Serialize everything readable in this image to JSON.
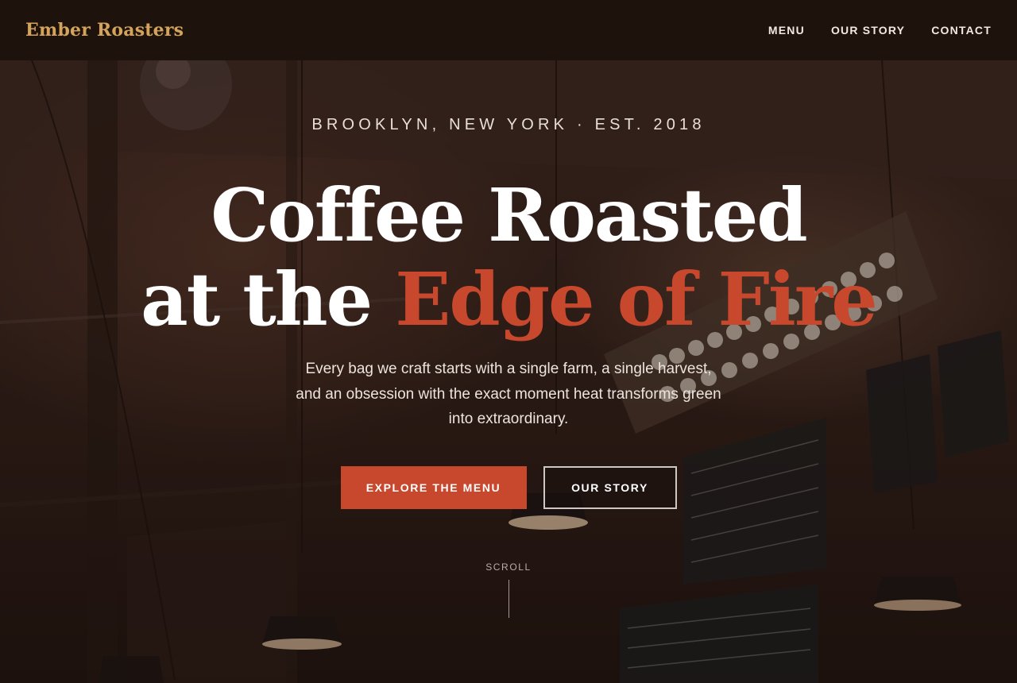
{
  "header": {
    "brand": "Ember Roasters",
    "nav": [
      {
        "label": "MENU"
      },
      {
        "label": "OUR STORY"
      },
      {
        "label": "CONTACT"
      }
    ]
  },
  "hero": {
    "eyebrow": "BROOKLYN, NEW YORK · EST. 2018",
    "headline_line1": "Coffee Roasted",
    "headline_line2_plain": "at the ",
    "headline_line2_accent": "Edge of Fire",
    "subtext": "Every bag we craft starts with a single farm, a single harvest, and an obsession with the exact moment heat transforms green into extraordinary.",
    "primary_cta": "EXPLORE THE MENU",
    "secondary_cta": "OUR STORY",
    "scroll_label": "SCROLL"
  },
  "colors": {
    "header_bg": "#1e120c",
    "brand": "#d4a45c",
    "accent": "#c8482e",
    "text_light": "#f1e9e2"
  }
}
